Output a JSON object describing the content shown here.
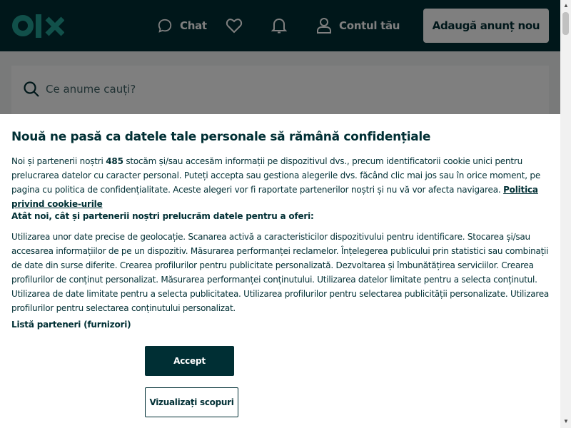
{
  "header": {
    "logo": "olx",
    "logo_icon": "olx-logo",
    "nav": {
      "chat_label": "Chat",
      "chat_icon": "chat-bubble-icon",
      "favorites_icon": "heart-icon",
      "notifications_icon": "bell-icon",
      "account_label": "Contul tău",
      "account_icon": "user-icon"
    },
    "post_button_label": "Adaugă anunț nou"
  },
  "search": {
    "placeholder": "Ce anume cauți?",
    "icon": "search-icon"
  },
  "consent": {
    "title": "Nouă ne pasă ca datele tale personale să rămână confidențiale",
    "intro_before_count": "Noi și partenerii noștri ",
    "partner_count": "485",
    "intro_after_count": " stocăm și/sau accesăm informații pe dispozitivul dvs., precum identificatorii cookie unici pentru prelucrarea datelor cu caracter personal. Puteți accepta sau gestiona alegerile dvs. făcând clic mai jos sau în orice moment, pe pagina cu politica de confidențialitate. Aceste alegeri vor fi raportate partenerilor noștri și nu vă vor afecta navigarea. ",
    "cookie_policy_link": "Politica privind cookie-urile",
    "purposes_heading": "Atât noi, cât și partenerii noștri prelucrăm datele pentru a oferi:",
    "purposes_text": "Utilizarea unor date precise de geolocație. Scanarea activă a caracteristicilor dispozitivului pentru identificare. Stocarea și/sau accesarea informațiilor de pe un dispozitiv. Măsurarea performanței reclamelor. Înțelegerea publicului prin statistici sau combinații de date din surse diferite. Crearea profilurilor pentru publicitate personalizată. Dezvoltarea și îmbunătățirea serviciilor. Crearea profilurilor de conținut personalizat. Măsurarea performanței conținutului. Utilizarea datelor limitate pentru a selecta conținutul. Utilizarea de date limitate pentru a selecta publicitatea. Utilizarea profilurilor pentru selectarea publicității personalizate. Utilizarea profilurilor pentru selectarea conținutului personalizat.",
    "partners_link": "Listă parteneri (furnizori)",
    "accept_label": "Accept",
    "view_purposes_label": "Vizualizați scopuri"
  },
  "colors": {
    "brand_dark": "#002f34",
    "brand_teal": "#23e5db",
    "white": "#ffffff"
  }
}
